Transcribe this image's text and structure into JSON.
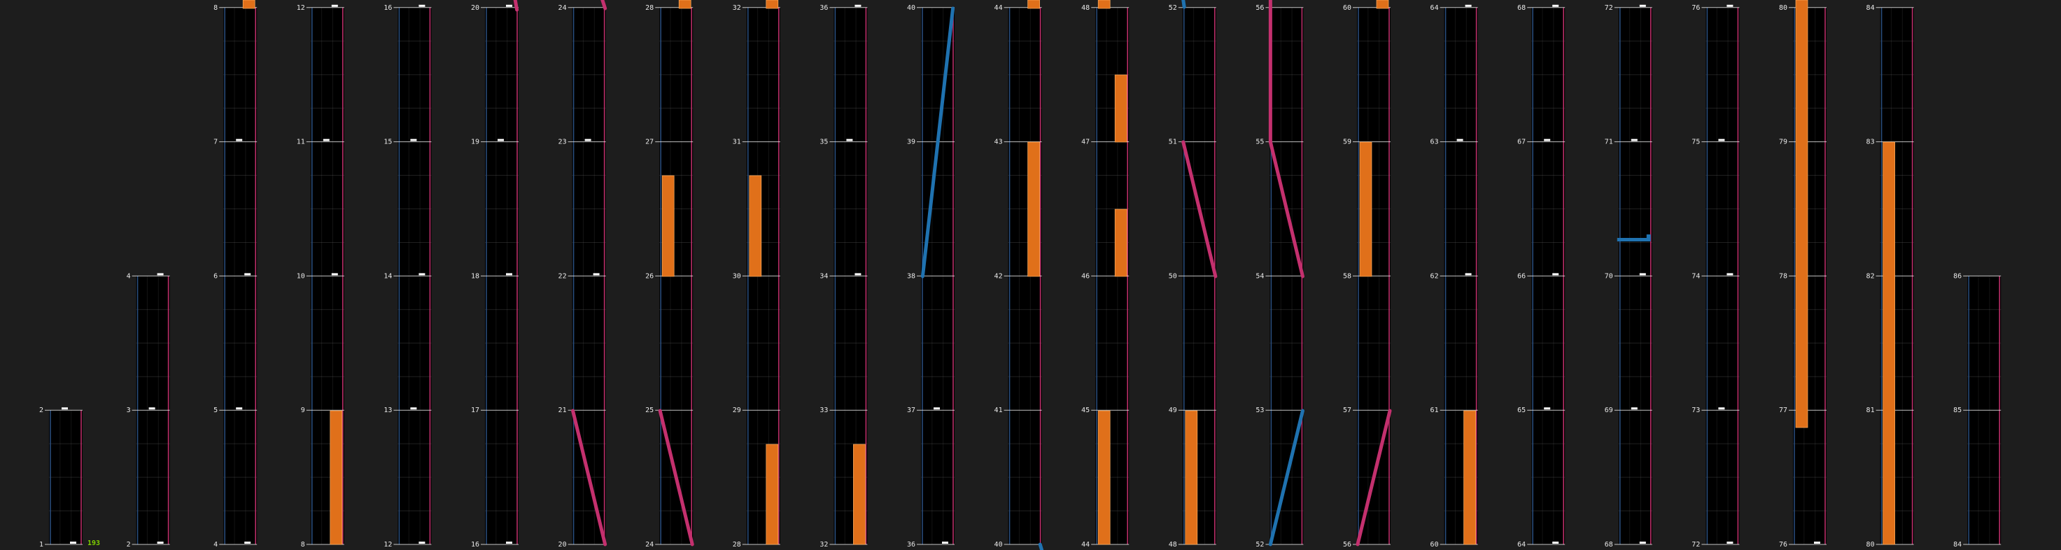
{
  "combo": "193",
  "colors": {
    "background": "#1d1d1d",
    "lane": "#000000",
    "lane_border_left": "#2a4f80",
    "lane_border_right": "#c4306e",
    "grid_line": "#ffffff",
    "hold_note": "#e0701a",
    "slide_pink": "#c4306e",
    "slide_blue": "#1f72b0",
    "tap_note": "#ffffff",
    "combo_text": "#7fd000"
  },
  "columns": [
    {
      "measures": [
        1,
        2
      ]
    },
    {
      "measures": [
        2,
        3,
        4
      ]
    },
    {
      "measures": [
        4,
        5,
        6,
        7,
        8
      ]
    },
    {
      "measures": [
        8,
        9,
        10,
        11,
        12
      ]
    },
    {
      "measures": [
        12,
        13,
        14,
        15,
        16
      ]
    },
    {
      "measures": [
        16,
        17,
        18,
        19,
        20
      ]
    },
    {
      "measures": [
        20,
        21,
        22,
        23,
        24
      ]
    },
    {
      "measures": [
        24,
        25,
        26,
        27,
        28
      ]
    },
    {
      "measures": [
        28,
        29,
        30,
        31,
        32
      ]
    },
    {
      "measures": [
        32,
        33,
        34,
        35,
        36
      ]
    },
    {
      "measures": [
        36,
        37,
        38,
        39,
        40
      ]
    },
    {
      "measures": [
        40,
        41,
        42,
        43,
        44
      ]
    },
    {
      "measures": [
        44,
        45,
        46,
        47,
        48
      ]
    },
    {
      "measures": [
        48,
        49,
        50,
        51,
        52
      ]
    },
    {
      "measures": [
        52,
        53,
        54,
        55,
        56
      ]
    },
    {
      "measures": [
        56,
        57,
        58,
        59,
        60
      ]
    },
    {
      "measures": [
        60,
        61,
        62,
        63,
        64
      ]
    },
    {
      "measures": [
        64,
        65,
        66,
        67,
        68
      ]
    },
    {
      "measures": [
        68,
        69,
        70,
        71,
        72
      ]
    },
    {
      "measures": [
        72,
        73,
        74,
        75,
        76
      ]
    },
    {
      "measures": [
        76,
        77,
        78,
        79,
        80
      ]
    },
    {
      "measures": [
        80,
        81,
        82,
        83,
        84
      ]
    },
    {
      "measures": [
        84,
        85,
        86
      ]
    }
  ]
}
